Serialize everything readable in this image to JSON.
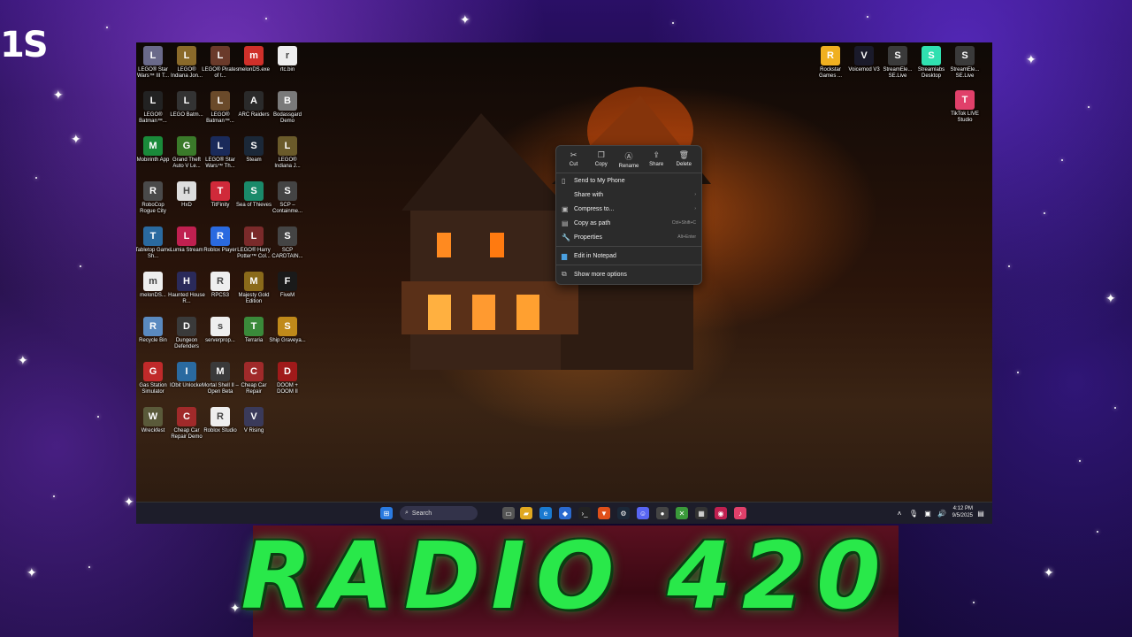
{
  "overlay": {
    "corner_text": "1S",
    "banner_title": "RADIO 420"
  },
  "desktop_icons": [
    {
      "label": "LEGO® Star Wars™ III T...",
      "icon": "lego-sw-icon",
      "color": "#6a6a8a"
    },
    {
      "label": "LEGO® Indiana Jon...",
      "icon": "lego-indy-icon",
      "color": "#8a6a2a"
    },
    {
      "label": "LEGO® Pirates of t...",
      "icon": "lego-pirates-icon",
      "color": "#6a3a2a"
    },
    {
      "label": "melonDS.exe",
      "icon": "melon-icon",
      "color": "#d0302a"
    },
    {
      "label": "rtc.bin",
      "icon": "file-icon",
      "color": "#eeeeee"
    },
    {
      "label": "LEGO® Batman™...",
      "icon": "lego-batman-icon",
      "color": "#222222"
    },
    {
      "label": "LEGO Batm...",
      "icon": "lego-batman2-icon",
      "color": "#333333"
    },
    {
      "label": "LEGO® Batman™...",
      "icon": "lego-batman3-icon",
      "color": "#6a4a2a"
    },
    {
      "label": "ARC Raiders",
      "icon": "arc-icon",
      "color": "#2a2a2a"
    },
    {
      "label": "Bodassgard Demo",
      "icon": "temple-icon",
      "color": "#7a7a7a"
    },
    {
      "label": "Mobirinth App",
      "icon": "mobi-icon",
      "color": "#1a8a3a"
    },
    {
      "label": "Grand Theft Auto V Le...",
      "icon": "gta-icon",
      "color": "#3a7a2a"
    },
    {
      "label": "LEGO® Star Wars™ Th...",
      "icon": "lego-sw2-icon",
      "color": "#1a2a5a"
    },
    {
      "label": "Steam",
      "icon": "steam-icon",
      "color": "#1b2838"
    },
    {
      "label": "LEGO® Indiana J...",
      "icon": "lego-indy2-icon",
      "color": "#6a5a2a"
    },
    {
      "label": "RoboCop Rogue City",
      "icon": "robocop-icon",
      "color": "#4a4a4a"
    },
    {
      "label": "HxD",
      "icon": "hxd-icon",
      "color": "#dddddd"
    },
    {
      "label": "TitFinity",
      "icon": "titfinity-icon",
      "color": "#d02a3a"
    },
    {
      "label": "Sea of Thieves",
      "icon": "sot-icon",
      "color": "#1a8a6a"
    },
    {
      "label": "SCP – Containme...",
      "icon": "scp-icon",
      "color": "#444444"
    },
    {
      "label": "Tabletop Game Sh...",
      "icon": "tabletop-icon",
      "color": "#2a6aa0"
    },
    {
      "label": "Lumia Stream",
      "icon": "lumia-icon",
      "color": "#c02050"
    },
    {
      "label": "Roblox Player",
      "icon": "roblox-icon",
      "color": "#2a6ae0"
    },
    {
      "label": "LEGO® Harry Potter™ Col...",
      "icon": "lego-hp-icon",
      "color": "#7a2a2a"
    },
    {
      "label": "SCP CARDTAIN...",
      "icon": "scp2-icon",
      "color": "#444444"
    },
    {
      "label": "melonDS...",
      "icon": "file-icon",
      "color": "#eeeeee"
    },
    {
      "label": "Haunted House R...",
      "icon": "haunted-icon",
      "color": "#2a2a5a"
    },
    {
      "label": "RPCS3",
      "icon": "file-icon",
      "color": "#eeeeee"
    },
    {
      "label": "Majesty Gold Edition",
      "icon": "majesty-icon",
      "color": "#8a6a1a"
    },
    {
      "label": "FiveM",
      "icon": "fivem-icon",
      "color": "#1a1a1a"
    },
    {
      "label": "Recycle Bin",
      "icon": "recycle-bin-icon",
      "color": "#5a8ac0"
    },
    {
      "label": "Dungeon Defenders",
      "icon": "dungeon-icon",
      "color": "#3a3a3a"
    },
    {
      "label": "serverprop...",
      "icon": "file-icon",
      "color": "#eeeeee"
    },
    {
      "label": "Terraria",
      "icon": "terraria-icon",
      "color": "#3a8a3a"
    },
    {
      "label": "Ship Graveya...",
      "icon": "ship-icon",
      "color": "#c08a1a"
    },
    {
      "label": "Gas Station Simulator",
      "icon": "gas-icon",
      "color": "#c02a2a"
    },
    {
      "label": "IObit Unlocker",
      "icon": "unlock-icon",
      "color": "#2a6aa0"
    },
    {
      "label": "Mortal Shell II – Open Beta",
      "icon": "mortal-icon",
      "color": "#3a3a3a"
    },
    {
      "label": "Cheap Car Repair",
      "icon": "car-icon",
      "color": "#a02a2a"
    },
    {
      "label": "DOOM + DOOM II",
      "icon": "doom-icon",
      "color": "#a01a1a"
    },
    {
      "label": "Wreckfest",
      "icon": "wreck-icon",
      "color": "#5a5a3a"
    },
    {
      "label": "Cheap Car Repair Demo",
      "icon": "car2-icon",
      "color": "#a02a2a"
    },
    {
      "label": "Roblox Studio",
      "icon": "roblox-studio-icon",
      "color": "#eeeeee"
    },
    {
      "label": "V Rising",
      "icon": "vrising-icon",
      "color": "#3a3a5a"
    }
  ],
  "right_icons": [
    {
      "label": "Rockstar Games ...",
      "icon": "rockstar-icon",
      "color": "#f0b020"
    },
    {
      "label": "Voicemod V3",
      "icon": "voicemod-icon",
      "color": "#1a1a2a"
    },
    {
      "label": "StreamEle... SE.Live",
      "icon": "se-icon",
      "color": "#3a3a3a"
    },
    {
      "label": "Streamlabs Desktop",
      "icon": "streamlabs-icon",
      "color": "#30e0b0"
    },
    {
      "label": "StreamEle... SE.Live",
      "icon": "se2-icon",
      "color": "#3a3a3a"
    },
    {
      "label": "TikTok LIVE Studio",
      "icon": "tiktok-icon",
      "color": "#e0406a"
    }
  ],
  "context_menu": {
    "toolbar": [
      "Cut",
      "Copy",
      "Rename",
      "Share",
      "Delete"
    ],
    "items": [
      {
        "label": "Send to My Phone",
        "shortcut": "",
        "submenu": false
      },
      {
        "label": "Share with",
        "shortcut": "",
        "submenu": true
      },
      {
        "label": "Compress to...",
        "shortcut": "",
        "submenu": true
      },
      {
        "label": "Copy as path",
        "shortcut": "Ctrl+Shift+C",
        "submenu": false
      },
      {
        "label": "Properties",
        "shortcut": "Alt+Enter",
        "submenu": false
      },
      {
        "label": "Edit in Notepad",
        "shortcut": "",
        "submenu": false
      },
      {
        "label": "Show more options",
        "shortcut": "",
        "submenu": false
      }
    ]
  },
  "taskbar": {
    "search_label": "Search",
    "time": "4:12 PM",
    "date": "9/5/2025"
  }
}
